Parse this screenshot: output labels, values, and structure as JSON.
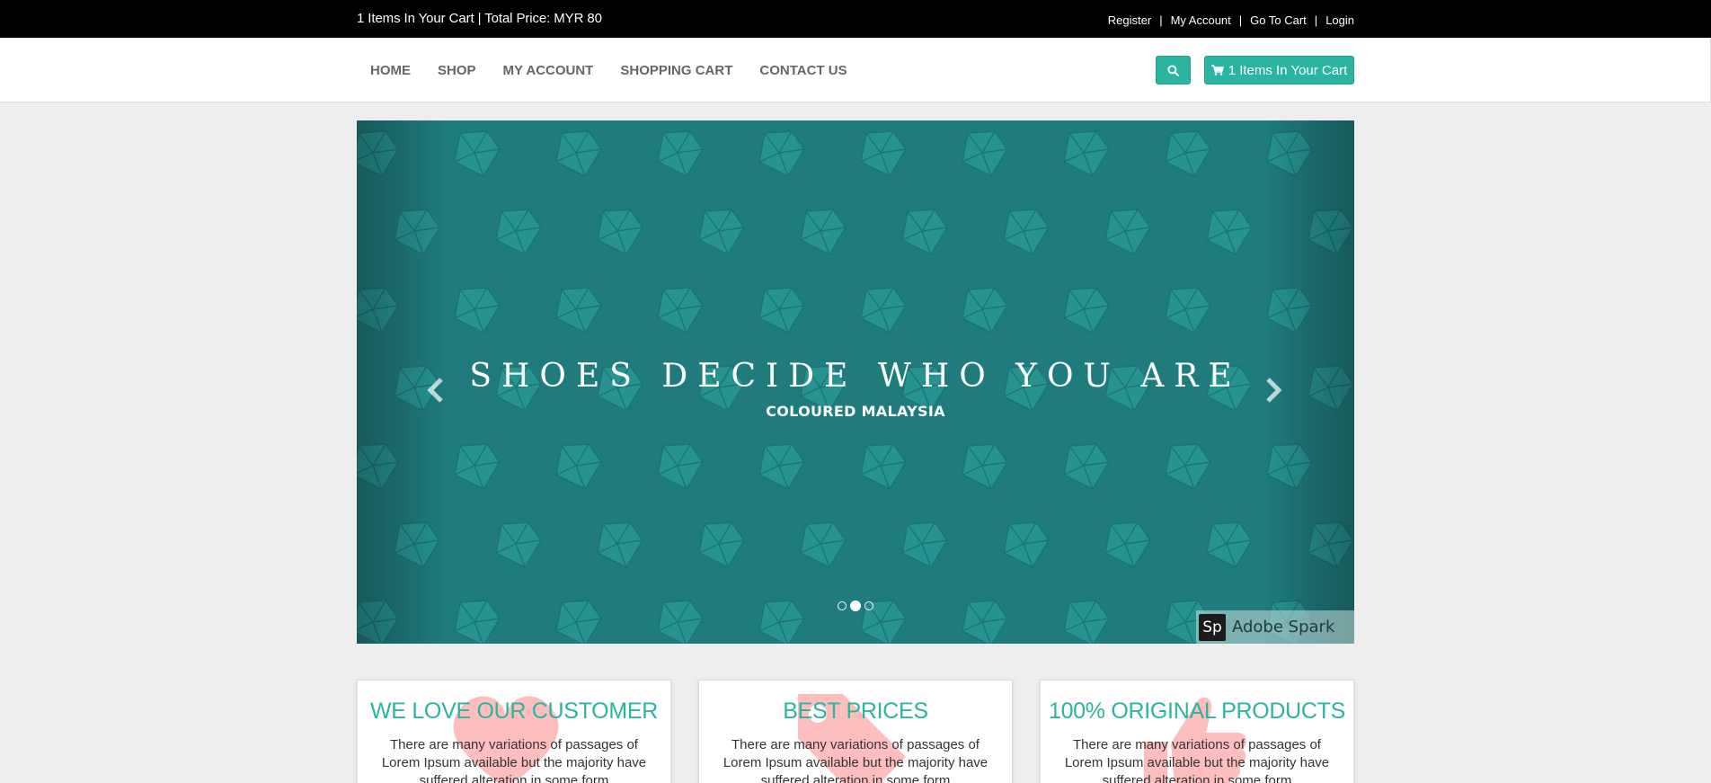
{
  "topbar": {
    "cart_summary": "1 Items In Your Cart | Total Price: MYR 80",
    "links": [
      "Register",
      "My Account",
      "Go To Cart",
      "Login"
    ],
    "separator": "|"
  },
  "nav": {
    "items": [
      "HOME",
      "SHOP",
      "MY ACCOUNT",
      "SHOPPING CART",
      "CONTACT US"
    ],
    "search_icon": "search-icon",
    "cart_button_label": "1 Items In Your Cart",
    "cart_icon": "shopping-cart-icon"
  },
  "carousel": {
    "headline": "SHOES DECIDE WHO YOU ARE",
    "subline": "COLOURED MALAYSIA",
    "prev_icon": "chevron-left-icon",
    "next_icon": "chevron-right-icon",
    "active_slide": 2,
    "slide_count": 3,
    "watermark_logo": "Sp",
    "watermark_text": "Adobe Spark"
  },
  "features": [
    {
      "title": "WE LOVE OUR CUSTOMER",
      "text": "There are many variations of passages of Lorem Ipsum available but the majority have suffered alteration in some form",
      "icon": "heart-icon"
    },
    {
      "title": "BEST PRICES",
      "text": "There are many variations of passages of Lorem Ipsum available but the majority have suffered alteration in some form",
      "icon": "price-tag-icon"
    },
    {
      "title": "100% ORIGINAL PRODUCTS",
      "text": "There are many variations of passages of Lorem Ipsum available but the majority have suffered alteration in some form",
      "icon": "thumbs-up-icon"
    }
  ],
  "colors": {
    "accent": "#2bb5a0",
    "topbar": "#000000",
    "banner": "#1f7b7c",
    "watermark_icon": "#ffb3b3"
  }
}
